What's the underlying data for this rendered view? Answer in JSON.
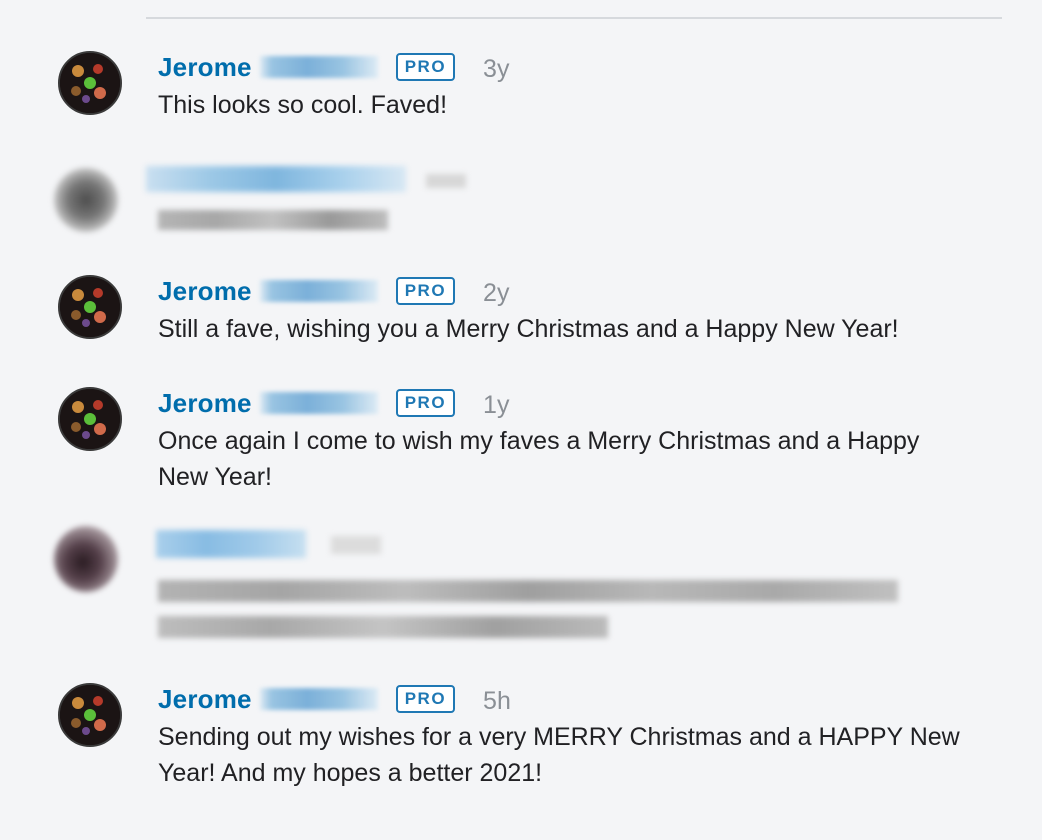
{
  "comments": [
    {
      "author": "Jerome",
      "badge": "PRO",
      "age": "3y",
      "text": "This looks so cool. Faved!"
    },
    {
      "author": "Jerome",
      "badge": "PRO",
      "age": "2y",
      "text": "Still a fave, wishing you a Merry Christmas and a Happy New Year!"
    },
    {
      "author": "Jerome",
      "badge": "PRO",
      "age": "1y",
      "text": "Once again I come to wish my faves a Merry Christmas and a Happy New Year!"
    },
    {
      "author": "Jerome",
      "badge": "PRO",
      "age": "5h",
      "text": "Sending out my wishes for a very MERRY Christmas and a HAPPY New Year! And my hopes a better 2021!"
    }
  ],
  "colors": {
    "author": "#006dac",
    "badge": "#1f78b4",
    "text": "#212124",
    "muted": "#8a8f95",
    "background": "#f4f5f7"
  }
}
